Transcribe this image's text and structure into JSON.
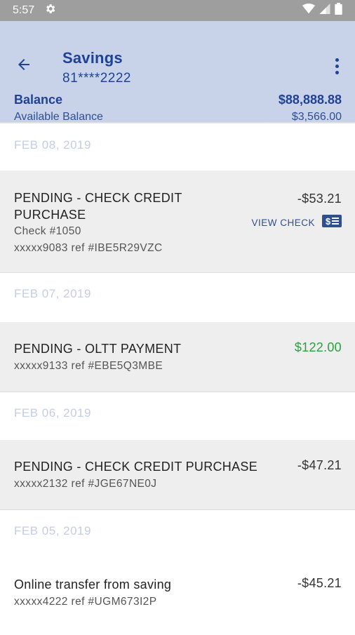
{
  "status_bar": {
    "time": "5:57"
  },
  "header": {
    "title": "Savings",
    "account_number": "81****2222",
    "balance_label": "Balance",
    "balance_value": "$88,888.88",
    "available_label": "Available Balance",
    "available_value": "$3,566.00"
  },
  "transactions": [
    {
      "date": "FEB 08, 2019",
      "description": "PENDING - CHECK CREDIT PURCHASE",
      "check": "Check #1050",
      "reference": "xxxxx9083 ref #IBE5R29VZC",
      "amount": "-$53.21",
      "action": "VIEW CHECK"
    },
    {
      "date": "FEB 07, 2019",
      "description": "PENDING - OLTT PAYMENT",
      "reference": "xxxxx9133 ref #EBE5Q3MBE",
      "amount": "$122.00"
    },
    {
      "date": "FEB 06, 2019",
      "description": "PENDING - CHECK CREDIT PURCHASE",
      "reference": "xxxxx2132 ref #JGE67NE0J",
      "amount": "-$47.21"
    },
    {
      "date": "FEB 05, 2019",
      "description": "Online transfer from saving",
      "reference": "xxxxx4222 ref #UGM673I2P",
      "amount": "-$45.21"
    }
  ],
  "icons": {
    "back": "arrow-back-icon",
    "menu": "more-vert-icon",
    "settings": "gear-icon",
    "check": "check-document-icon"
  },
  "colors": {
    "header_bg": "#c8d3ea",
    "brand_blue": "#1f4294",
    "credit_green": "#2e9e45",
    "date_text": "#c5cde6"
  }
}
